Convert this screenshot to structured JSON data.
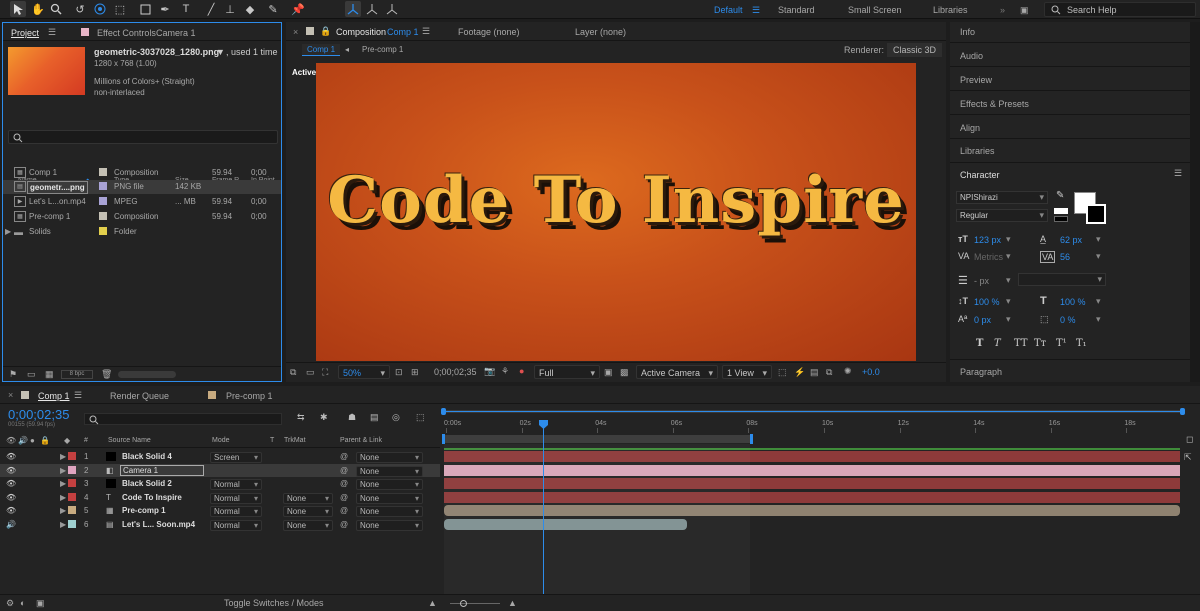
{
  "toolbar": {
    "workspaces": [
      "Default",
      "Standard",
      "Small Screen",
      "Libraries"
    ],
    "search_placeholder": "Search Help"
  },
  "project": {
    "tab_project": "Project",
    "tab_effect_controls": "Effect Controls",
    "effect_controls_target": "Camera 1",
    "selected_name": "geometric-3037028_1280.png",
    "used": ", used 1 time",
    "dimensions": "1280 x 768 (1.00)",
    "colors": "Millions of Colors+ (Straight)",
    "interlace": "non-interlaced",
    "search_icon_text": "",
    "columns": [
      "Name",
      "Type",
      "Size",
      "Frame R...",
      "In Point"
    ],
    "items": [
      {
        "name": "Comp 1",
        "type": "Composition",
        "size": "",
        "fps": "59.94",
        "in": "0;00",
        "color": "#c4c0b4"
      },
      {
        "name": "geometr....png",
        "type": "PNG file",
        "size": "142 KB",
        "fps": "",
        "in": "",
        "color": "#a9a3d6"
      },
      {
        "name": "Let's L...on.mp4",
        "type": "MPEG",
        "size": "... MB",
        "fps": "59.94",
        "in": "0;00",
        "color": "#a9a3d6"
      },
      {
        "name": "Pre-comp 1",
        "type": "Composition",
        "size": "",
        "fps": "59.94",
        "in": "0;00",
        "color": "#c4c0b4"
      },
      {
        "name": "Solids",
        "type": "Folder",
        "size": "",
        "fps": "",
        "in": "",
        "color": "#e2cf4c"
      }
    ],
    "bpc": "8 bpc"
  },
  "comp": {
    "tab_label": "Composition",
    "tab_comp": "Comp 1",
    "footage": "Footage (none)",
    "layer": "Layer (none)",
    "breadcrumb_1": "Comp 1",
    "breadcrumb_2": "Pre-comp 1",
    "renderer_label": "Renderer:",
    "renderer_value": "Classic 3D",
    "active_camera_label": "Active Camera",
    "viewer_text": "Code To Inspire",
    "zoom": "50%",
    "timecode": "0;00;02;35",
    "resolution": "Full",
    "view_camera": "Active Camera",
    "views": "1 View",
    "exposure": "+0.0"
  },
  "right": {
    "sections": [
      "Info",
      "Audio",
      "Preview",
      "Effects & Presets",
      "Align",
      "Libraries"
    ],
    "character_title": "Character",
    "paragraph_title": "Paragraph",
    "font_family": "NPIShirazi",
    "font_style": "Regular",
    "font_size": "123 px",
    "leading": "62 px",
    "kerning": "Metrics",
    "tracking": "56",
    "stroke_width": "- px",
    "vert_scale": "100 %",
    "horiz_scale": "100 %",
    "baseline": "0 px",
    "tsume": "0 %",
    "text_styles": [
      "T",
      "T",
      "TT",
      "Tт",
      "T¹",
      "T₁"
    ]
  },
  "timeline": {
    "tab_comp": "Comp 1",
    "tab_render": "Render Queue",
    "tab_precomp": "Pre-comp 1",
    "timecode": "0;00;02;35",
    "fps_sub": "00155 (59.94 fps)",
    "col_hash": "#",
    "col_source": "Source Name",
    "col_mode": "Mode",
    "col_t": "T",
    "col_trkmat": "TrkMat",
    "col_parent": "Parent & Link",
    "ruler": [
      "0:00s",
      "02s",
      "04s",
      "06s",
      "08s",
      "10s",
      "12s",
      "14s",
      "16s",
      "18s"
    ],
    "toggle_label": "Toggle Switches / Modes",
    "layers": [
      {
        "num": "1",
        "name": "Black Solid 4",
        "mode": "Screen",
        "trkmat": "",
        "parent": "None",
        "label": "#c44040",
        "bar": "#8e3a3a"
      },
      {
        "num": "2",
        "name": "Camera 1",
        "mode": "",
        "trkmat": "",
        "parent": "None",
        "label": "#e0a4c0",
        "bar": "#d9a6b8"
      },
      {
        "num": "3",
        "name": "Black Solid 2",
        "mode": "Normal",
        "trkmat": "",
        "parent": "None",
        "label": "#c44040",
        "bar": "#8e3a3a"
      },
      {
        "num": "4",
        "name": "Code To Inspire",
        "mode": "Normal",
        "trkmat": "None",
        "parent": "None",
        "label": "#c44040",
        "bar": "#8e3a3a"
      },
      {
        "num": "5",
        "name": "Pre-comp 1",
        "mode": "Normal",
        "trkmat": "None",
        "parent": "None",
        "label": "#c8ab80",
        "bar": "#8f8270"
      },
      {
        "num": "6",
        "name": "Let's L... Soon.mp4",
        "mode": "Normal",
        "trkmat": "None",
        "parent": "None",
        "label": "#9fd0d0",
        "bar": "#7f9192"
      }
    ]
  },
  "colors": {
    "accent": "#2d8ceb",
    "panel": "#232323",
    "background": "#1d1d1d"
  }
}
